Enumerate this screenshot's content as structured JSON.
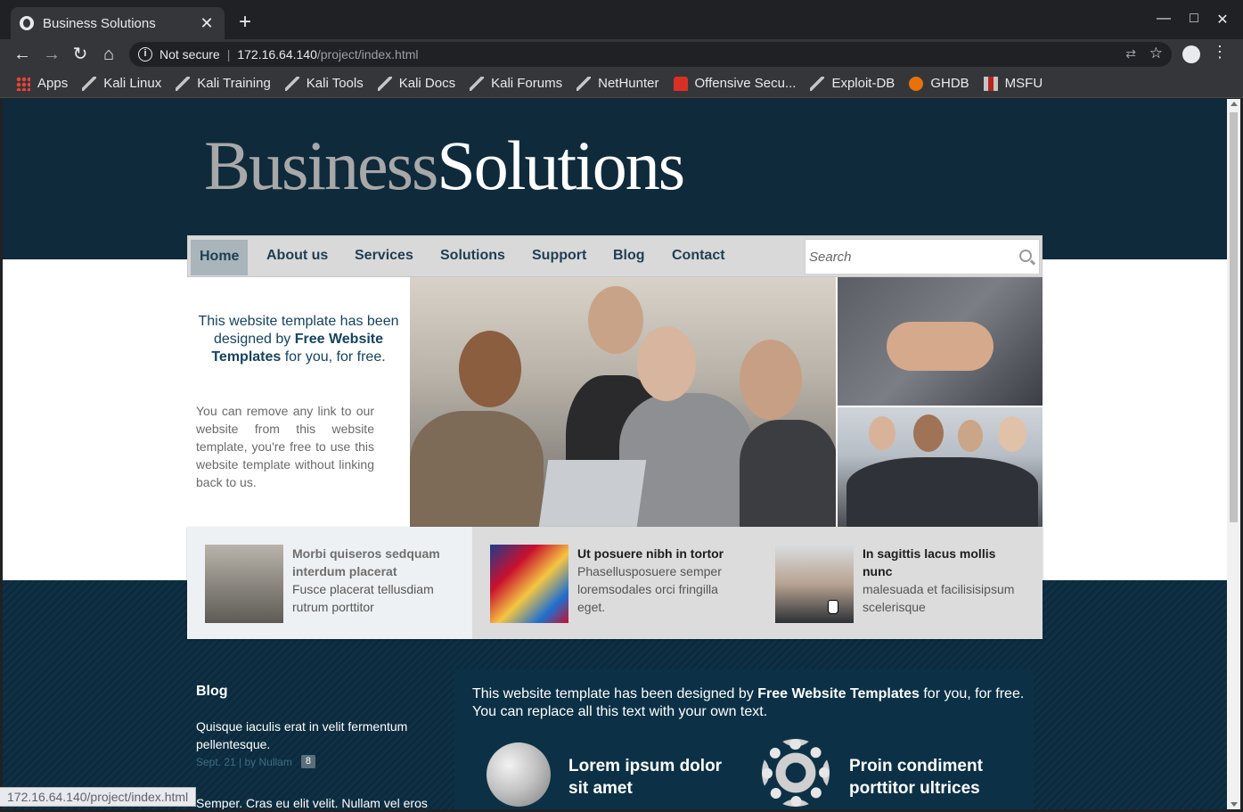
{
  "browser": {
    "tab_title": "Business Solutions",
    "tab_close": "✕",
    "new_tab": "+",
    "window_controls": {
      "minimize": "—",
      "maximize": "□",
      "close": "✕"
    },
    "nav": {
      "back": "←",
      "forward": "→",
      "reload": "↻",
      "home": "⌂"
    },
    "address": {
      "security_label": "Not secure",
      "host": "172.16.64.140",
      "path": "/project/index.html"
    },
    "translate_icon": "translate-icon",
    "star": "☆",
    "menu": "⋮",
    "bookmarks": [
      {
        "label": "Apps",
        "icon": "apps-grid-icon"
      },
      {
        "label": "Kali Linux",
        "icon": "kali-dragon-icon"
      },
      {
        "label": "Kali Training",
        "icon": "kali-dragon-icon"
      },
      {
        "label": "Kali Tools",
        "icon": "kali-dragon-icon"
      },
      {
        "label": "Kali Docs",
        "icon": "kali-dragon-icon"
      },
      {
        "label": "Kali Forums",
        "icon": "kali-dragon-icon"
      },
      {
        "label": "NetHunter",
        "icon": "nethunter-icon"
      },
      {
        "label": "Offensive Secu...",
        "icon": "offsec-icon"
      },
      {
        "label": "Exploit-DB",
        "icon": "exploitdb-icon"
      },
      {
        "label": "GHDB",
        "icon": "ghdb-icon"
      },
      {
        "label": "MSFU",
        "icon": "msfu-icon"
      }
    ],
    "status_url": "172.16.64.140/project/index.html"
  },
  "site": {
    "logo_part1": "Business",
    "logo_part2": "Solutions",
    "nav": [
      "Home",
      "About us",
      "Services",
      "Solutions",
      "Support",
      "Blog",
      "Contact"
    ],
    "search_placeholder": "Search",
    "intro": {
      "lead_before": "This website template has been designed by ",
      "lead_bold": "Free Website Templates",
      "lead_after": " for you, for free.",
      "body": "You can remove any link to our website from this website template, you're free to use this website template without linking back to us."
    },
    "features": [
      {
        "title": "Morbi quiseros sedquam interdum placerat",
        "text": "Fusce placerat tellusdiam rutrum porttitor"
      },
      {
        "title": "Ut posuere nibh in tortor",
        "text": "Phasellusposuere semper loremsodales orci fringilla eget."
      },
      {
        "title": "In sagittis lacus mollis nunc",
        "text": "malesuada et facilisisipsum scelerisque"
      }
    ],
    "blog": {
      "heading": "Blog",
      "post1_text": "Quisque iaculis erat in velit fermentum pellentesque.",
      "post1_meta": "Sept. 21 | by Nullam",
      "post1_comments": "8",
      "post2_text": "Semper. Cras eu elit velit. Nullam vel eros"
    },
    "content": {
      "text_before": "This website template has been designed by ",
      "text_bold": "Free Website Templates",
      "text_after": " for you, for free. You can replace all this text with your own text.",
      "service1": "Lorem ipsum dolor sit amet",
      "service2": "Proin condiment porttitor ultrices"
    }
  }
}
